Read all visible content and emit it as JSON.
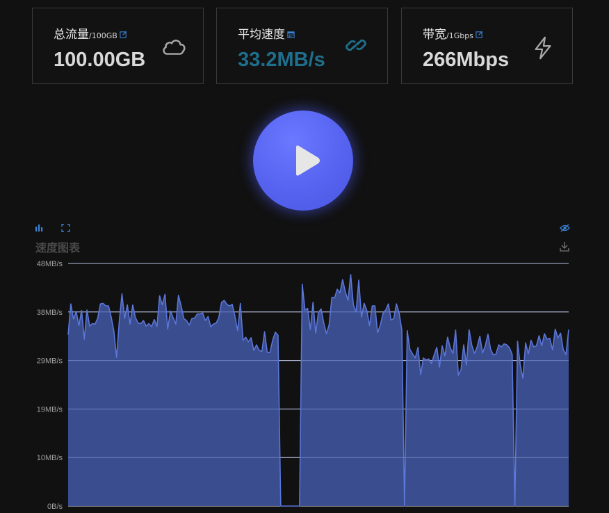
{
  "cards": [
    {
      "title": "总流量",
      "suffix": "/100GB",
      "value": "100.00GB",
      "mini_icon": "edit-icon",
      "icon": "cloud-icon"
    },
    {
      "title": "平均速度",
      "suffix": "",
      "value": "33.2MB/s",
      "mini_icon": "calendar-icon",
      "icon": "link-icon"
    },
    {
      "title": "带宽",
      "suffix": "/1Gbps",
      "value": "266Mbps",
      "mini_icon": "edit-icon",
      "icon": "lightning-icon"
    }
  ],
  "colors": {
    "background": "#111111",
    "card_border": "#3a3a3a",
    "accent_value": "#1e6e8c",
    "small_icon_blue": "#3b82d6",
    "play_button": "#5563f0",
    "series_line": "#5b76d9",
    "series_fill": "#3d5196"
  },
  "play_button": {
    "icon": "play-icon"
  },
  "chart_toolbar": {
    "left": [
      "bar-chart-icon",
      "fullscreen-icon"
    ],
    "right": [
      "hide-eye-icon",
      "download-icon"
    ]
  },
  "chart_data": {
    "type": "area",
    "title": "速度图表",
    "xlabel": "",
    "ylabel": "",
    "y_tick_labels": [
      "0B/s",
      "10MB/s",
      "19MB/s",
      "29MB/s",
      "38MB/s",
      "48MB/s"
    ],
    "ylim": [
      0,
      48
    ],
    "grid": true,
    "series": [
      {
        "values": [
          33.9,
          40.0,
          37.0,
          38.5,
          35.7,
          38.7,
          33.0,
          38.8,
          35.6,
          36.1,
          36.0,
          37.2,
          40.0,
          40.1,
          39.6,
          39.6,
          37.4,
          34.6,
          29.4,
          36.5,
          42.0,
          37.1,
          39.8,
          36.0,
          39.8,
          37.3,
          36.2,
          36.1,
          36.7,
          35.6,
          36.1,
          35.5,
          36.9,
          35.5,
          41.6,
          39.8,
          41.9,
          35.0,
          38.6,
          37.3,
          36.0,
          41.7,
          39.6,
          37.1,
          36.7,
          35.8,
          37.1,
          37.2,
          38.0,
          38.0,
          38.2,
          36.7,
          37.5,
          35.5,
          36.0,
          36.2,
          37.3,
          40.3,
          40.7,
          39.9,
          39.6,
          39.9,
          37.5,
          34.7,
          40.1,
          32.8,
          33.4,
          32.5,
          33.3,
          30.8,
          31.9,
          30.8,
          30.6,
          34.5,
          30.4,
          30.4,
          32.8,
          34.4,
          33.8,
          0.0,
          0.0,
          0.0,
          0.0,
          0.0,
          0.0,
          0.0,
          0.0,
          43.9,
          38.8,
          39.1,
          34.9,
          40.3,
          34.2,
          38.3,
          39.0,
          36.2,
          34.1,
          35.9,
          41.3,
          41.2,
          42.9,
          42.2,
          44.8,
          42.4,
          40.7,
          45.8,
          39.8,
          38.4,
          44.7,
          37.4,
          40.1,
          38.7,
          35.7,
          39.6,
          39.6,
          34.3,
          35.8,
          38.1,
          38.8,
          40.0,
          36.8,
          37.1,
          40.0,
          38.2,
          34.8,
          0.0,
          34.7,
          31.0,
          30.1,
          29.3,
          31.4,
          26.0,
          29.3,
          28.9,
          29.1,
          28.2,
          29.9,
          31.4,
          27.5,
          31.7,
          29.7,
          33.4,
          31.3,
          30.2,
          34.8,
          25.9,
          27.0,
          31.9,
          27.9,
          34.9,
          31.8,
          30.2,
          31.5,
          33.6,
          30.3,
          31.7,
          34.0,
          31.0,
          29.9,
          30.1,
          31.9,
          31.5,
          32.1,
          31.9,
          31.3,
          30.0,
          0.0,
          32.6,
          27.9,
          25.3,
          32.3,
          30.1,
          32.8,
          31.5,
          31.7,
          33.7,
          31.7,
          34.1,
          33.0,
          33.2,
          30.9,
          35.0,
          33.3,
          34.2,
          30.9,
          30.0,
          34.9
        ]
      }
    ]
  }
}
